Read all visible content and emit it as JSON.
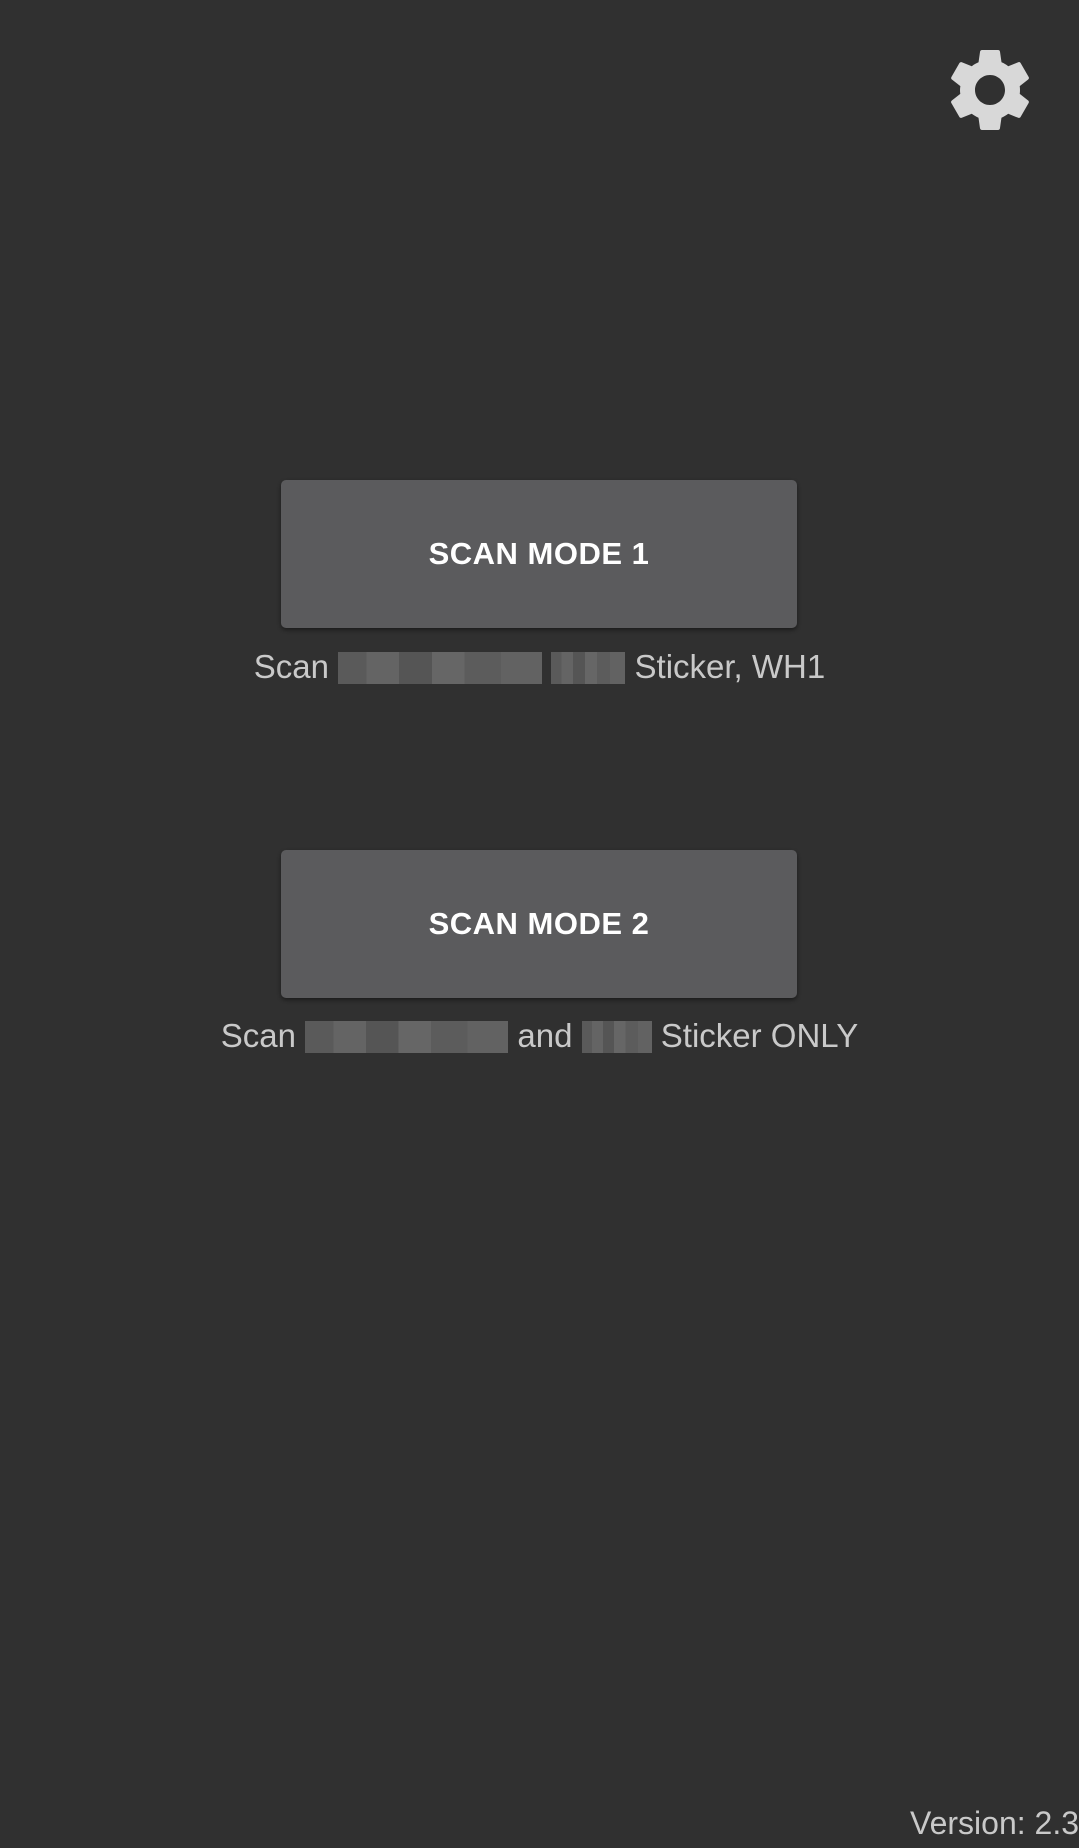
{
  "settings": {
    "icon": "gear-icon"
  },
  "mode1": {
    "button_label": "SCAN MODE 1",
    "desc_prefix": "Scan",
    "desc_suffix": "Sticker, WH1"
  },
  "mode2": {
    "button_label": "SCAN MODE 2",
    "desc_prefix": "Scan",
    "desc_middle": "and",
    "desc_suffix": "Sticker ONLY"
  },
  "footer": {
    "version": "Version: 2.3"
  },
  "colors": {
    "background": "#303030",
    "button": "#5b5b5d",
    "button_text": "#ffffff",
    "secondary_text": "#c9c9c9",
    "icon": "#d8d8d8"
  }
}
